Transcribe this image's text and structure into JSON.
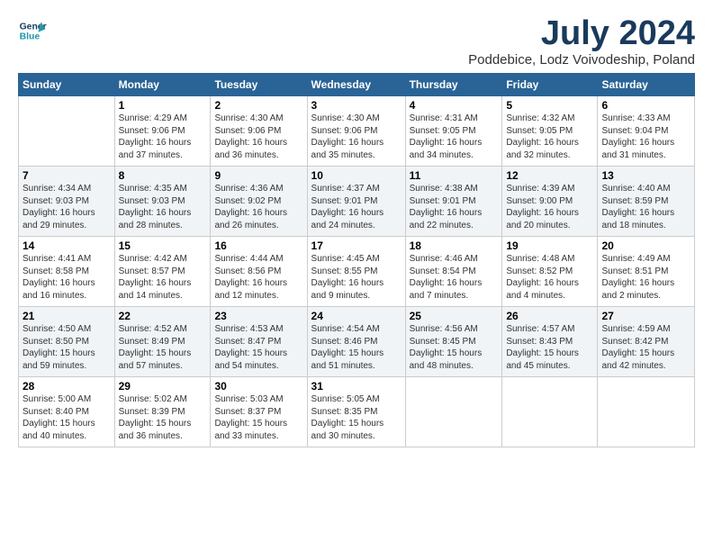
{
  "logo": {
    "line1": "General",
    "line2": "Blue"
  },
  "title": "July 2024",
  "subtitle": "Poddebice, Lodz Voivodeship, Poland",
  "weekdays": [
    "Sunday",
    "Monday",
    "Tuesday",
    "Wednesday",
    "Thursday",
    "Friday",
    "Saturday"
  ],
  "weeks": [
    [
      {
        "day": "",
        "info": ""
      },
      {
        "day": "1",
        "info": "Sunrise: 4:29 AM\nSunset: 9:06 PM\nDaylight: 16 hours\nand 37 minutes."
      },
      {
        "day": "2",
        "info": "Sunrise: 4:30 AM\nSunset: 9:06 PM\nDaylight: 16 hours\nand 36 minutes."
      },
      {
        "day": "3",
        "info": "Sunrise: 4:30 AM\nSunset: 9:06 PM\nDaylight: 16 hours\nand 35 minutes."
      },
      {
        "day": "4",
        "info": "Sunrise: 4:31 AM\nSunset: 9:05 PM\nDaylight: 16 hours\nand 34 minutes."
      },
      {
        "day": "5",
        "info": "Sunrise: 4:32 AM\nSunset: 9:05 PM\nDaylight: 16 hours\nand 32 minutes."
      },
      {
        "day": "6",
        "info": "Sunrise: 4:33 AM\nSunset: 9:04 PM\nDaylight: 16 hours\nand 31 minutes."
      }
    ],
    [
      {
        "day": "7",
        "info": "Sunrise: 4:34 AM\nSunset: 9:03 PM\nDaylight: 16 hours\nand 29 minutes."
      },
      {
        "day": "8",
        "info": "Sunrise: 4:35 AM\nSunset: 9:03 PM\nDaylight: 16 hours\nand 28 minutes."
      },
      {
        "day": "9",
        "info": "Sunrise: 4:36 AM\nSunset: 9:02 PM\nDaylight: 16 hours\nand 26 minutes."
      },
      {
        "day": "10",
        "info": "Sunrise: 4:37 AM\nSunset: 9:01 PM\nDaylight: 16 hours\nand 24 minutes."
      },
      {
        "day": "11",
        "info": "Sunrise: 4:38 AM\nSunset: 9:01 PM\nDaylight: 16 hours\nand 22 minutes."
      },
      {
        "day": "12",
        "info": "Sunrise: 4:39 AM\nSunset: 9:00 PM\nDaylight: 16 hours\nand 20 minutes."
      },
      {
        "day": "13",
        "info": "Sunrise: 4:40 AM\nSunset: 8:59 PM\nDaylight: 16 hours\nand 18 minutes."
      }
    ],
    [
      {
        "day": "14",
        "info": "Sunrise: 4:41 AM\nSunset: 8:58 PM\nDaylight: 16 hours\nand 16 minutes."
      },
      {
        "day": "15",
        "info": "Sunrise: 4:42 AM\nSunset: 8:57 PM\nDaylight: 16 hours\nand 14 minutes."
      },
      {
        "day": "16",
        "info": "Sunrise: 4:44 AM\nSunset: 8:56 PM\nDaylight: 16 hours\nand 12 minutes."
      },
      {
        "day": "17",
        "info": "Sunrise: 4:45 AM\nSunset: 8:55 PM\nDaylight: 16 hours\nand 9 minutes."
      },
      {
        "day": "18",
        "info": "Sunrise: 4:46 AM\nSunset: 8:54 PM\nDaylight: 16 hours\nand 7 minutes."
      },
      {
        "day": "19",
        "info": "Sunrise: 4:48 AM\nSunset: 8:52 PM\nDaylight: 16 hours\nand 4 minutes."
      },
      {
        "day": "20",
        "info": "Sunrise: 4:49 AM\nSunset: 8:51 PM\nDaylight: 16 hours\nand 2 minutes."
      }
    ],
    [
      {
        "day": "21",
        "info": "Sunrise: 4:50 AM\nSunset: 8:50 PM\nDaylight: 15 hours\nand 59 minutes."
      },
      {
        "day": "22",
        "info": "Sunrise: 4:52 AM\nSunset: 8:49 PM\nDaylight: 15 hours\nand 57 minutes."
      },
      {
        "day": "23",
        "info": "Sunrise: 4:53 AM\nSunset: 8:47 PM\nDaylight: 15 hours\nand 54 minutes."
      },
      {
        "day": "24",
        "info": "Sunrise: 4:54 AM\nSunset: 8:46 PM\nDaylight: 15 hours\nand 51 minutes."
      },
      {
        "day": "25",
        "info": "Sunrise: 4:56 AM\nSunset: 8:45 PM\nDaylight: 15 hours\nand 48 minutes."
      },
      {
        "day": "26",
        "info": "Sunrise: 4:57 AM\nSunset: 8:43 PM\nDaylight: 15 hours\nand 45 minutes."
      },
      {
        "day": "27",
        "info": "Sunrise: 4:59 AM\nSunset: 8:42 PM\nDaylight: 15 hours\nand 42 minutes."
      }
    ],
    [
      {
        "day": "28",
        "info": "Sunrise: 5:00 AM\nSunset: 8:40 PM\nDaylight: 15 hours\nand 40 minutes."
      },
      {
        "day": "29",
        "info": "Sunrise: 5:02 AM\nSunset: 8:39 PM\nDaylight: 15 hours\nand 36 minutes."
      },
      {
        "day": "30",
        "info": "Sunrise: 5:03 AM\nSunset: 8:37 PM\nDaylight: 15 hours\nand 33 minutes."
      },
      {
        "day": "31",
        "info": "Sunrise: 5:05 AM\nSunset: 8:35 PM\nDaylight: 15 hours\nand 30 minutes."
      },
      {
        "day": "",
        "info": ""
      },
      {
        "day": "",
        "info": ""
      },
      {
        "day": "",
        "info": ""
      }
    ]
  ]
}
